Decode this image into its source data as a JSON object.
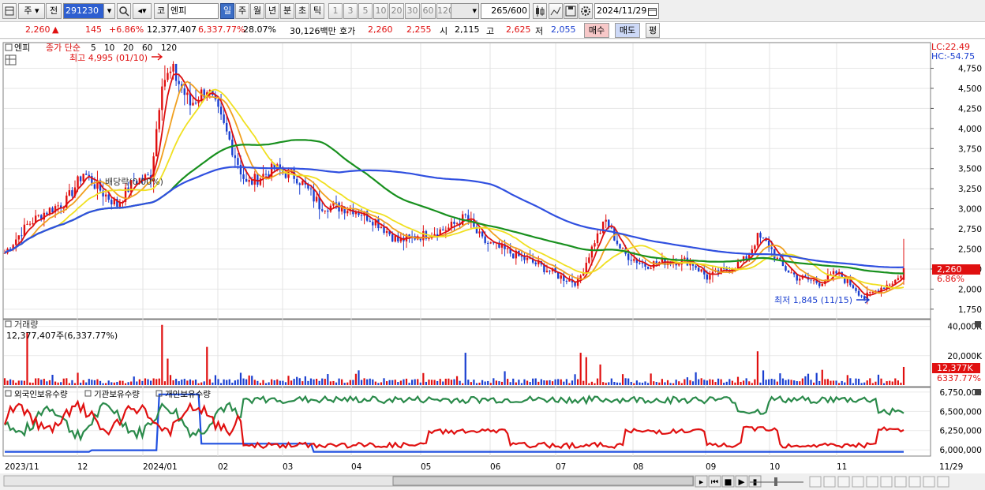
{
  "toolbar": {
    "market_type": "주",
    "prev": "전",
    "code": "291230",
    "market": "코",
    "name": "엔피",
    "periods": [
      "일",
      "주",
      "월",
      "년",
      "분",
      "초",
      "틱"
    ],
    "period_selected": "일",
    "minutes": [
      "1",
      "3",
      "5",
      "10",
      "20",
      "30",
      "60",
      "120"
    ],
    "count": "265",
    "count_total": "/600",
    "date": "2024/11/29"
  },
  "quote": {
    "price": "2,260",
    "arrow": "▲",
    "change": "145",
    "change_pct": "+6.86%",
    "volume": "12,377,407",
    "volume_pct": "6,337.77%",
    "turnover_rate": "28.07%",
    "amount": "30,126백만",
    "hoga_label": "호가",
    "ask": "2,260",
    "bid": "2,255",
    "open_label": "시",
    "open": "2,115",
    "high_label": "고",
    "high": "2,625",
    "low_label": "저",
    "low": "2,055",
    "buy_button": "매수",
    "sell_button": "매도",
    "avg_button": "평"
  },
  "price_panel": {
    "stock_label": "엔피",
    "ma_label": "종가 단순",
    "ma_periods": [
      "5",
      "10",
      "20",
      "60",
      "120"
    ],
    "ma_colors": [
      "#dc1010",
      "#f0a020",
      "#f0e020",
      "#18901e",
      "#3050e0"
    ],
    "lc": "LC:22.49",
    "hc": "HC:-54.75",
    "high_note": "최고 4,995 (01/10)",
    "low_note": "최저 1,845 (11/15)",
    "event_note": "배당락(0.00%)",
    "current_price_tag": "2,260",
    "current_pct_tag": "6.86%"
  },
  "volume_panel": {
    "title": "거래량",
    "value_text": "12,377,407주(6,337.77%)",
    "tag_value": "12,377K",
    "tag_pct": "6337.77%"
  },
  "holdings_panel": {
    "series_names": [
      "외국인보유수량",
      "기관보유수량",
      "개인보유수량"
    ],
    "series_colors": [
      "#e01010",
      "#2050e0",
      "#2a8a4a"
    ]
  },
  "xaxis": {
    "labels": [
      "2023/11",
      "12",
      "2024/01",
      "02",
      "03",
      "04",
      "05",
      "06",
      "07",
      "08",
      "09",
      "10",
      "11",
      "11/29"
    ]
  },
  "chart_data": [
    {
      "type": "candlestick",
      "ylim": [
        1650,
        5050
      ],
      "yticks": [
        "1,750",
        "2,000",
        "2,250",
        "2,500",
        "2,750",
        "3,000",
        "3,250",
        "3,500",
        "3,750",
        "4,000",
        "4,250",
        "4,500",
        "4,750"
      ],
      "yvalues": [
        1750,
        2000,
        2250,
        2500,
        2750,
        3000,
        3250,
        3500,
        3750,
        4000,
        4250,
        4500,
        4750
      ],
      "close_anchors": [
        [
          0,
          2450
        ],
        [
          8,
          2800
        ],
        [
          14,
          2950
        ],
        [
          22,
          3100
        ],
        [
          28,
          3450
        ],
        [
          35,
          3200
        ],
        [
          40,
          3050
        ],
        [
          46,
          3350
        ],
        [
          52,
          3400
        ],
        [
          56,
          4600
        ],
        [
          60,
          4700
        ],
        [
          66,
          4300
        ],
        [
          72,
          4500
        ],
        [
          80,
          3850
        ],
        [
          86,
          3300
        ],
        [
          96,
          3500
        ],
        [
          104,
          3400
        ],
        [
          112,
          3050
        ],
        [
          124,
          3000
        ],
        [
          132,
          2850
        ],
        [
          140,
          2600
        ],
        [
          150,
          2680
        ],
        [
          158,
          2760
        ],
        [
          164,
          2900
        ],
        [
          170,
          2600
        ],
        [
          180,
          2450
        ],
        [
          190,
          2300
        ],
        [
          198,
          2150
        ],
        [
          204,
          2080
        ],
        [
          210,
          2600
        ],
        [
          214,
          2850
        ],
        [
          220,
          2450
        ],
        [
          228,
          2300
        ],
        [
          236,
          2350
        ],
        [
          244,
          2350
        ],
        [
          250,
          2150
        ],
        [
          258,
          2250
        ],
        [
          264,
          2380
        ],
        [
          268,
          2650
        ],
        [
          272,
          2550
        ],
        [
          276,
          2300
        ],
        [
          282,
          2150
        ],
        [
          290,
          2080
        ],
        [
          296,
          2200
        ],
        [
          302,
          2040
        ],
        [
          306,
          1890
        ],
        [
          312,
          2020
        ],
        [
          318,
          2130
        ],
        [
          320,
          2260
        ]
      ],
      "bars": 321,
      "last_bar": {
        "open": 2115,
        "high": 2625,
        "low": 2055,
        "close": 2260
      },
      "period_high": 4995,
      "period_low": 1845
    },
    {
      "type": "bar",
      "ylabel": "거래량",
      "yticks": [
        "20,000K",
        "40,000K"
      ],
      "yvalues": [
        20000,
        40000
      ],
      "last_value_k": 12377
    },
    {
      "type": "line",
      "ylabel": "보유수량",
      "yticks": [
        "6,000,000",
        "6,250,000",
        "6,500,000",
        "6,750,000"
      ],
      "yvalues": [
        6000000,
        6250000,
        6500000,
        6750000
      ],
      "ylim": [
        5940000,
        6790000
      ]
    }
  ]
}
